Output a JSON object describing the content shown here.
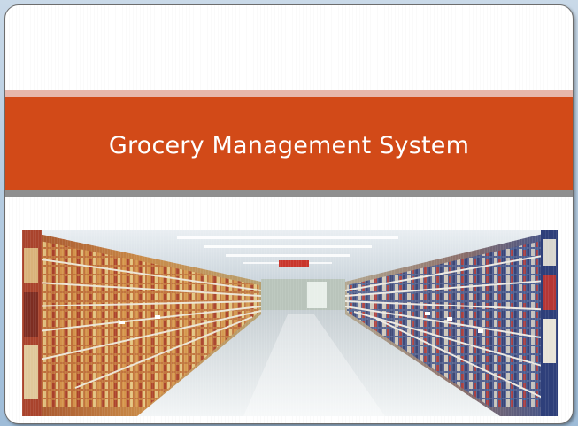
{
  "slide": {
    "title": "Grocery Management System"
  },
  "image": {
    "subject": "grocery store aisle with stocked shelves"
  },
  "colors": {
    "banner": "#d24a18",
    "band_top": "#e7b7ab",
    "band_bottom": "#8f8f8f",
    "frame": "#9ebcd8"
  }
}
